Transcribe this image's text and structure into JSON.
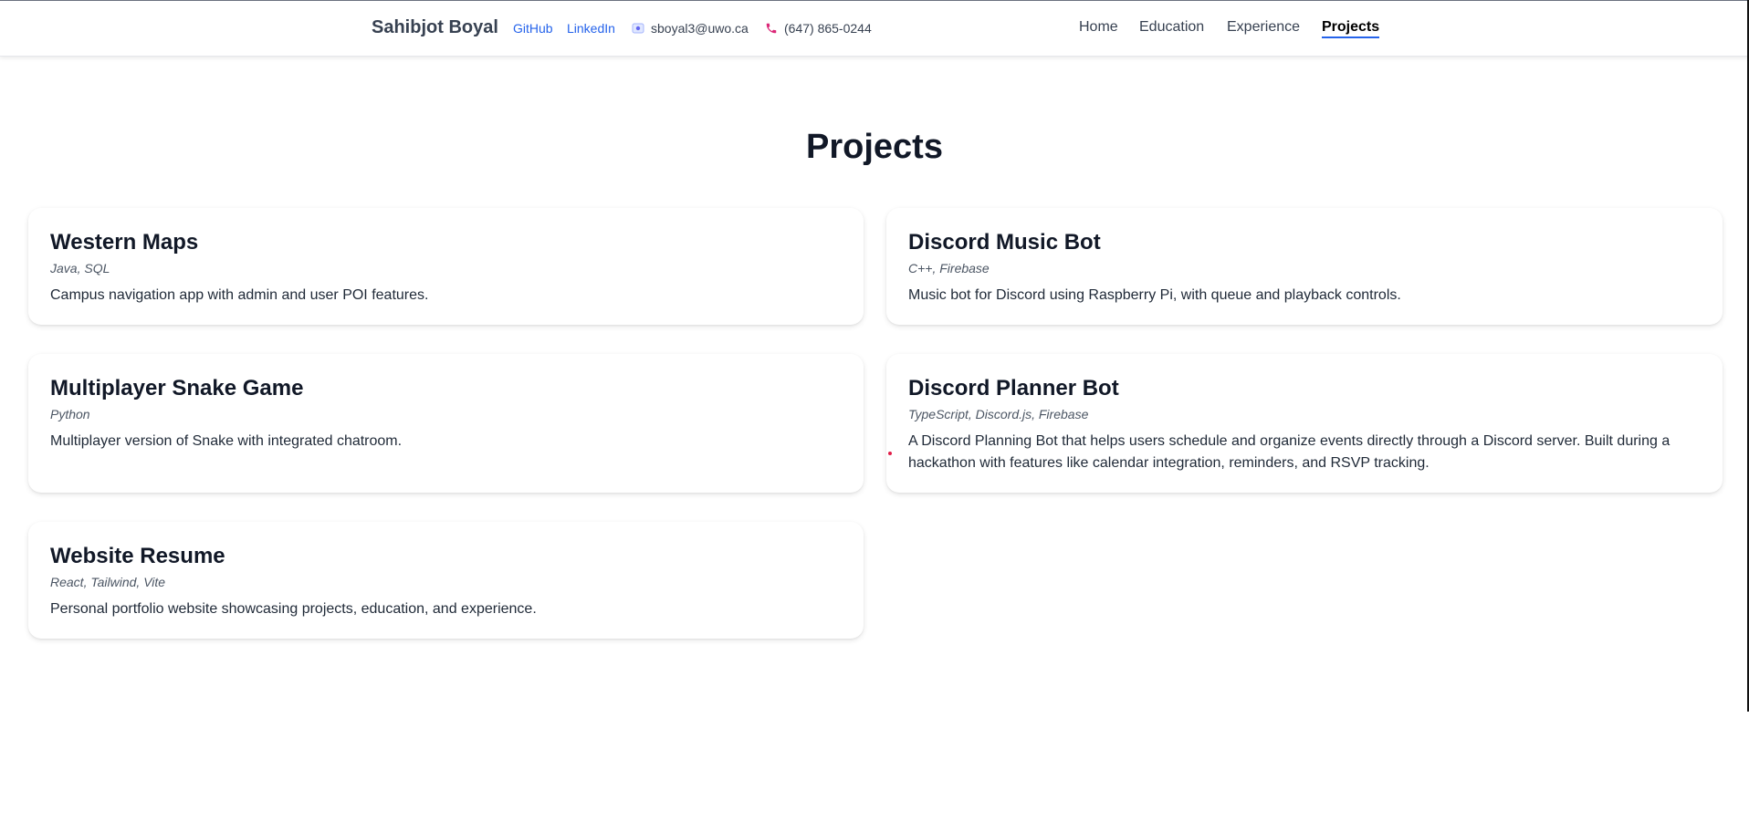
{
  "header": {
    "name": "Sahibjot Boyal",
    "github": "GitHub",
    "linkedin": "LinkedIn",
    "email": "sboyal3@uwo.ca",
    "phone": "(647) 865-0244",
    "icons": {
      "email": "email-icon",
      "phone": "phone-icon"
    },
    "nav": [
      "Home",
      "Education",
      "Experience",
      "Projects"
    ],
    "active_nav": "Projects"
  },
  "main": {
    "title": "Projects",
    "projects": [
      {
        "name": "Western Maps",
        "tech": "Java, SQL",
        "description": "Campus navigation app with admin and user POI features."
      },
      {
        "name": "Discord Music Bot",
        "tech": "C++, Firebase",
        "description": "Music bot for Discord using Raspberry Pi, with queue and playback controls."
      },
      {
        "name": "Multiplayer Snake Game",
        "tech": "Python",
        "description": "Multiplayer version of Snake with integrated chatroom."
      },
      {
        "name": "Discord Planner Bot",
        "tech": "TypeScript, Discord.js, Firebase",
        "description": "A Discord Planning Bot that helps users schedule and organize events directly through a Discord server. Built during a hackathon with features like calendar integration, reminders, and RSVP tracking."
      },
      {
        "name": "Website Resume",
        "tech": "React, Tailwind, Vite",
        "description": "Personal portfolio website showcasing projects, education, and experience."
      }
    ]
  },
  "colors": {
    "link": "#2563eb",
    "active_underline": "#2563eb",
    "phone_icon": "#db2777"
  }
}
